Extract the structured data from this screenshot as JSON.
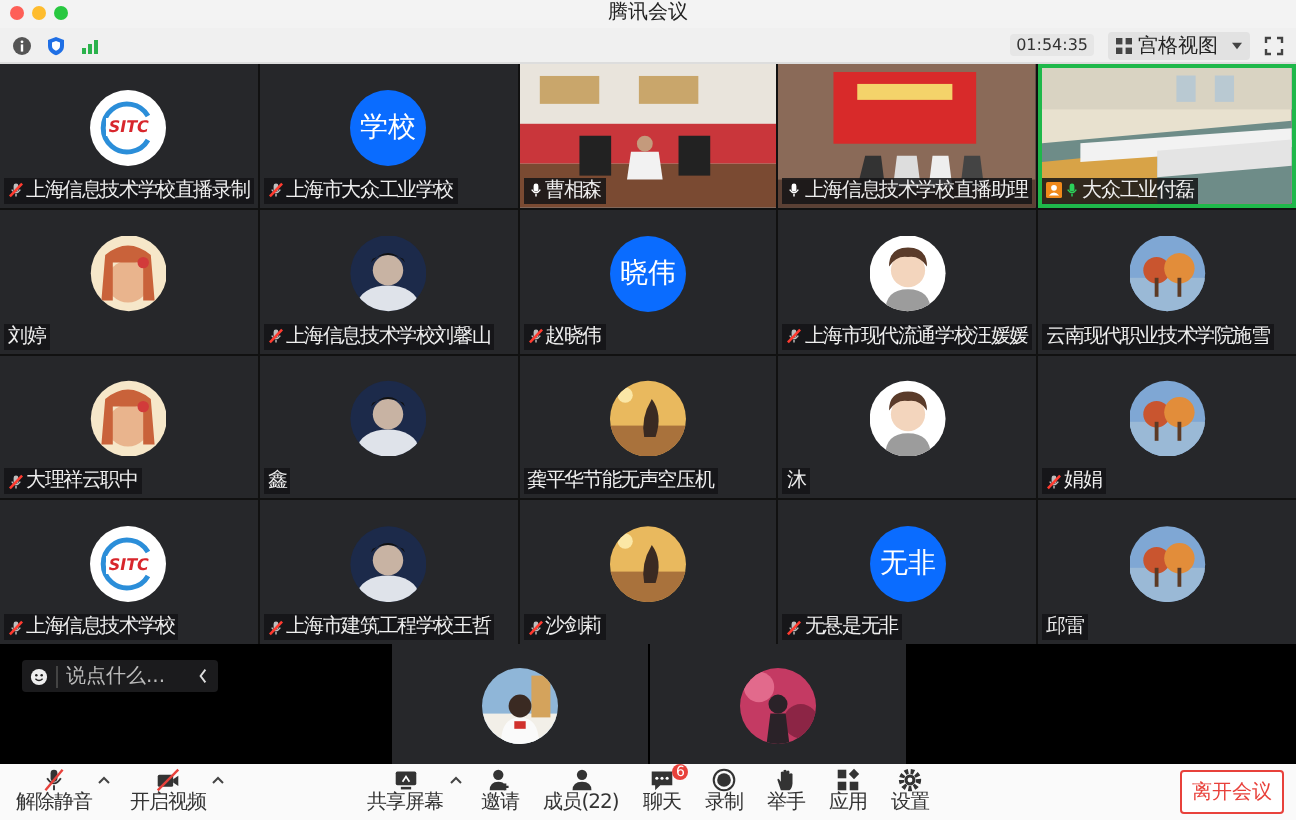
{
  "window": {
    "title": "腾讯会议"
  },
  "top_bar": {
    "timer": "01:54:35",
    "view_menu": "宫格视图"
  },
  "tiles": [
    {
      "name": "上海信息技术学校直播录制",
      "mic_shown": true,
      "muted": true,
      "kind": "logo",
      "avatar_text": "SITC",
      "speaking": false,
      "host": false
    },
    {
      "name": "上海市大众工业学校",
      "mic_shown": true,
      "muted": true,
      "kind": "text",
      "avatar_text": "学校",
      "speaking": false,
      "host": false
    },
    {
      "name": "曹相森",
      "mic_shown": true,
      "muted": false,
      "kind": "video",
      "speaking": false,
      "host": false
    },
    {
      "name": "上海信息技术学校直播助理",
      "mic_shown": true,
      "muted": false,
      "kind": "video",
      "speaking": false,
      "host": false
    },
    {
      "name": "大众工业付磊",
      "mic_shown": true,
      "muted": false,
      "kind": "video",
      "speaking": true,
      "host": true
    },
    {
      "name": "刘婷",
      "mic_shown": false,
      "kind": "picture",
      "speaking": false,
      "host": false
    },
    {
      "name": "上海信息技术学校刘馨山",
      "mic_shown": true,
      "muted": true,
      "kind": "picture",
      "speaking": false,
      "host": false
    },
    {
      "name": "赵晓伟",
      "mic_shown": true,
      "muted": true,
      "kind": "text",
      "avatar_text": "晓伟",
      "speaking": false,
      "host": false
    },
    {
      "name": "上海市现代流通学校汪媛媛",
      "mic_shown": true,
      "muted": true,
      "kind": "picture",
      "speaking": false,
      "host": false
    },
    {
      "name": "云南现代职业技术学院施雪",
      "mic_shown": false,
      "kind": "picture",
      "speaking": false,
      "host": false
    },
    {
      "name": "大理祥云职中",
      "mic_shown": true,
      "muted": true,
      "kind": "picture",
      "speaking": false,
      "host": false
    },
    {
      "name": "鑫",
      "mic_shown": false,
      "kind": "picture",
      "speaking": false,
      "host": false
    },
    {
      "name": "龚平华节能无声空压机",
      "mic_shown": false,
      "kind": "picture",
      "speaking": false,
      "host": false
    },
    {
      "name": "沐",
      "mic_shown": false,
      "kind": "picture",
      "speaking": false,
      "host": false
    },
    {
      "name": "娟娟",
      "mic_shown": true,
      "muted": true,
      "kind": "picture",
      "speaking": false,
      "host": false
    },
    {
      "name": "上海信息技术学校",
      "mic_shown": true,
      "muted": true,
      "kind": "logo",
      "avatar_text": "SITC",
      "speaking": false,
      "host": false
    },
    {
      "name": "上海市建筑工程学校王哲",
      "mic_shown": true,
      "muted": true,
      "kind": "picture",
      "speaking": false,
      "host": false
    },
    {
      "name": "沙剑莉",
      "mic_shown": true,
      "muted": true,
      "kind": "picture",
      "speaking": false,
      "host": false
    },
    {
      "name": "无悬是无非",
      "mic_shown": true,
      "muted": true,
      "kind": "text",
      "avatar_text": "无非",
      "speaking": false,
      "host": false
    },
    {
      "name": "邱雷",
      "mic_shown": false,
      "kind": "picture",
      "speaking": false,
      "host": false
    }
  ],
  "chat": {
    "placeholder": "说点什么..."
  },
  "toolbar": [
    {
      "label": "解除静音",
      "kind": "mic-off",
      "menu": true
    },
    {
      "label": "开启视频",
      "kind": "camera-off",
      "menu": true
    },
    {
      "label": "共享屏幕",
      "kind": "share",
      "menu": true
    },
    {
      "label": "邀请",
      "kind": "invite",
      "menu": false
    },
    {
      "label": "成员(22)",
      "kind": "members",
      "menu": false
    },
    {
      "label": "聊天",
      "kind": "chat",
      "menu": false,
      "badge": "6"
    },
    {
      "label": "录制",
      "kind": "record",
      "menu": false
    },
    {
      "label": "举手",
      "kind": "hand",
      "menu": false
    },
    {
      "label": "应用",
      "kind": "apps",
      "menu": false
    },
    {
      "label": "设置",
      "kind": "settings",
      "menu": false
    }
  ],
  "leave_button": "离开会议"
}
